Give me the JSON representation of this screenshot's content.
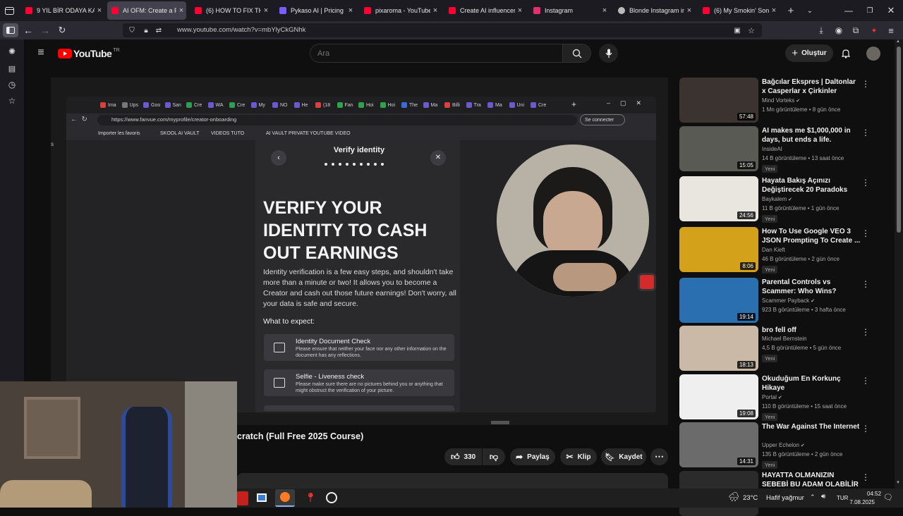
{
  "tabs": [
    {
      "title": "9 YIL BİR ODAYA KAPATI",
      "favicon": "youtube-icon",
      "active": false
    },
    {
      "title": "AI OFM: Create a P",
      "favicon": "youtube-icon",
      "active": true
    },
    {
      "title": "(6) HOW TO FIX THE PI",
      "favicon": "youtube-icon",
      "active": false
    },
    {
      "title": "Pykaso AI | Pricing",
      "favicon": "pykaso-icon",
      "active": false
    },
    {
      "title": "pixaroma - YouTube",
      "favicon": "youtube-icon",
      "active": false
    },
    {
      "title": "Create AI influencers lik",
      "favicon": "youtube-icon",
      "active": false
    },
    {
      "title": "Instagram",
      "favicon": "instagram-icon",
      "active": false
    },
    {
      "title": "Blonde Instagram influe",
      "favicon": "globe-icon",
      "active": false
    },
    {
      "title": "(6) My Smokin' Song -",
      "favicon": "youtube-icon",
      "active": false
    }
  ],
  "browser": {
    "url": "www.youtube.com/watch?v=mbYlyCkGNhk"
  },
  "youtube": {
    "logo": "YouTube",
    "region": "TR",
    "search_placeholder": "Ara",
    "create_label": "Oluştur"
  },
  "video": {
    "title_partial": "cratch (Full Free 2025 Course)",
    "likes": "330",
    "share_label": "Paylaş",
    "clip_label": "Klip",
    "save_label": "Kaydet"
  },
  "inner": {
    "url": "https://www.fanvue.com/myprofile/creator-onboarding",
    "connect_label": "Se connecter",
    "bookmarks": [
      "Importer les favoris",
      "SKOOL AI VAULT",
      "VIDEOS TUTO",
      "AI VAULT PRIVATE",
      "YOUTUBE VIDEO"
    ],
    "tab_labels": [
      "Ima",
      "Ups",
      "Goo",
      "San",
      "Cre",
      "WA",
      "Cre",
      "My",
      "NO",
      "He",
      "(18",
      "Fan",
      "Hoi",
      "Hoi",
      "The",
      "Ma",
      "Billi",
      "Tra",
      "Ma",
      "Uni",
      "Cre"
    ],
    "dialog_title": "Verify identity",
    "step_total": 9,
    "step_current": 8,
    "headline": [
      "VERIFY YOUR",
      "IDENTITY TO CASH",
      "OUT EARNINGS"
    ],
    "body": "Identity verification is a few easy steps, and shouldn't take more than a minute or two! It allows you to become a Creator and cash out those future earnings! Don't worry, all your data is safe and secure.",
    "expect_label": "What to expect:",
    "steps": [
      {
        "title": "Identity Document Check",
        "desc": "Please ensure that neither your face nor any other information on the document has any reflections."
      },
      {
        "title": "Selfie - Liveness check",
        "desc": "Please make sure there are no pictures behind you or anything that might obstruct the verification of your picture."
      }
    ]
  },
  "recommendations": [
    {
      "title": "Bağcılar Ekspres | Daltonlar x Casperlar x Çirkinler",
      "channel": "Mind Vorteks",
      "verified": true,
      "meta": "1 Mn görüntüleme • 8 gün önce",
      "duration": "57:48",
      "new": false,
      "thumb_color": "#3a3330"
    },
    {
      "title": "AI makes me $1,000,000 in days, but ends a life.",
      "channel": "InsideAI",
      "verified": false,
      "meta": "14 B görüntüleme • 13 saat önce",
      "duration": "15:05",
      "new": true,
      "thumb_color": "#5a5a55"
    },
    {
      "title": "Hayata Bakış Açınızı Değiştirecek 20 Paradoks",
      "channel": "Baykalem",
      "verified": true,
      "meta": "11 B görüntüleme • 1 gün önce",
      "duration": "24:56",
      "new": true,
      "thumb_color": "#e9e6e0"
    },
    {
      "title": "How To Use Google VEO 3 JSON Prompting To Create ...",
      "channel": "Dan Kieft",
      "verified": false,
      "meta": "46 B görüntüleme • 2 gün önce",
      "duration": "8:06",
      "new": true,
      "thumb_color": "#d4a11a"
    },
    {
      "title": "Parental Controls vs Scammer: Who Wins?",
      "channel": "Scammer Payback",
      "verified": true,
      "meta": "923 B görüntüleme • 3 hafta önce",
      "duration": "19:14",
      "new": false,
      "thumb_color": "#2a6fb0"
    },
    {
      "title": "bro fell off",
      "channel": "Michael Bernstein",
      "verified": false,
      "meta": "4,5 B görüntüleme • 5 gün önce",
      "duration": "18:13",
      "new": true,
      "thumb_color": "#c9b9a6"
    },
    {
      "title": "Okuduğum En Korkunç Hikaye",
      "channel": "Portal",
      "verified": true,
      "meta": "110 B görüntüleme • 15 saat önce",
      "duration": "19:08",
      "new": true,
      "thumb_color": "#efefef"
    },
    {
      "title": "The War Against The Internet",
      "channel": "Upper Echelon",
      "verified": true,
      "meta": "135 B görüntüleme • 2 gün önce",
      "duration": "14:31",
      "new": true,
      "thumb_color": "#6b6b6b"
    },
    {
      "title": "HAYATTA OLMANIZIN SEBEBİ BU ADAM OLABİLİR",
      "channel": "",
      "verified": false,
      "meta": "",
      "duration": "",
      "new": false,
      "thumb_color": "#2b2b2b"
    }
  ],
  "taskbar": {
    "weather": "23°C",
    "weather_desc": "Hafif yağmur",
    "lang": "TUR",
    "time": "04:52",
    "date": "7.08.2025"
  },
  "colors": {
    "youtube_red": "#ff0000",
    "bg": "#0f0f0f",
    "tab_active": "#42414d"
  }
}
